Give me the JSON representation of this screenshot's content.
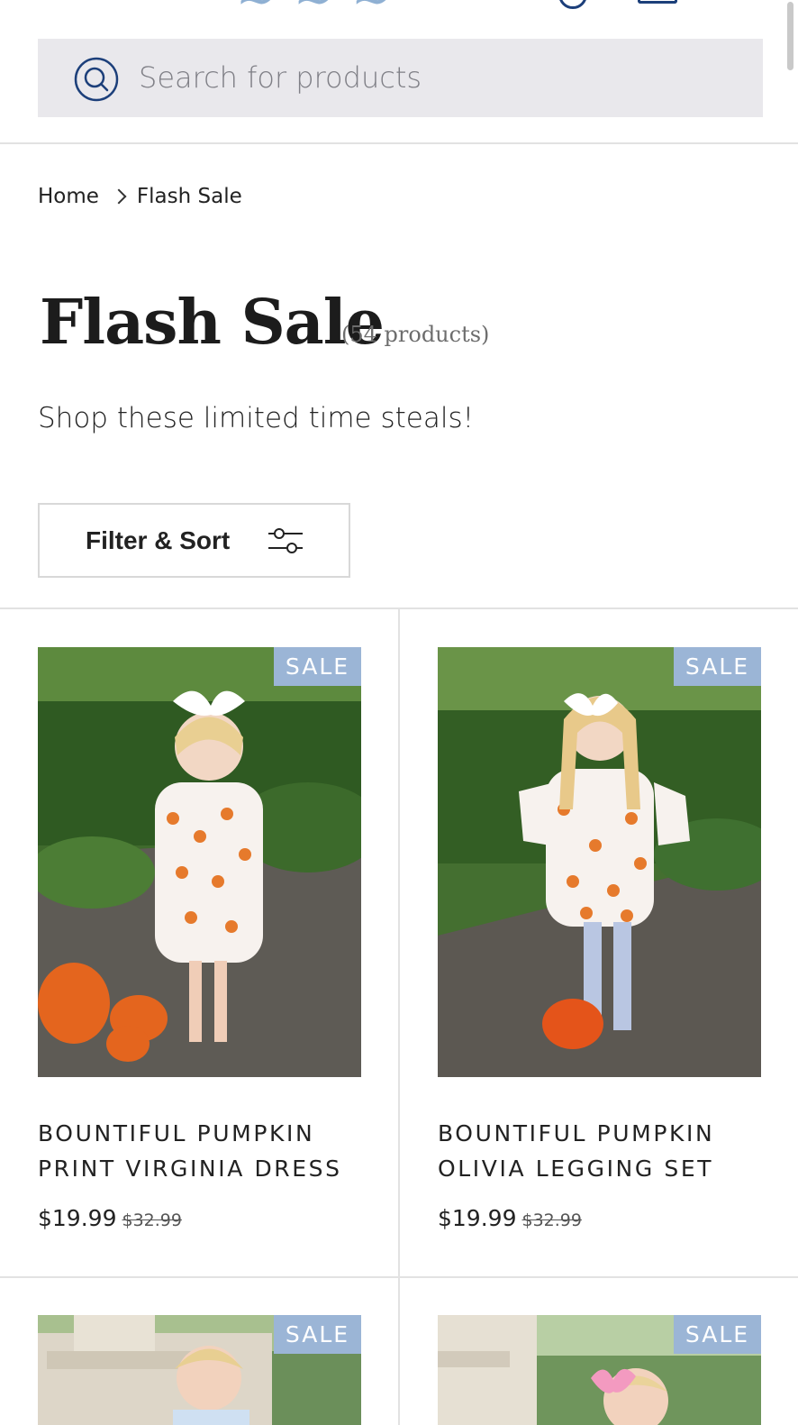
{
  "header": {
    "search_placeholder": "Search for products"
  },
  "breadcrumb": {
    "home": "Home",
    "current": "Flash Sale"
  },
  "collection": {
    "title": "Flash Sale",
    "count": "(54 products)",
    "description": "Shop these limited time steals!"
  },
  "filter": {
    "label": "Filter & Sort"
  },
  "products": [
    {
      "badge": "SALE",
      "title_line1": "BOUNTIFUL PUMPKIN",
      "title_line2": "PRINT VIRGINIA DRESS",
      "price": "$19.99",
      "compare_price": "$32.99"
    },
    {
      "badge": "SALE",
      "title_line1": "BOUNTIFUL PUMPKIN",
      "title_line2": "OLIVIA LEGGING SET",
      "price": "$19.99",
      "compare_price": "$32.99"
    },
    {
      "badge": "SALE"
    },
    {
      "badge": "SALE"
    }
  ],
  "colors": {
    "accent_blue": "#1c3f7a",
    "sale_badge": "#9bb5d6",
    "search_bg": "#e9e8ec"
  }
}
